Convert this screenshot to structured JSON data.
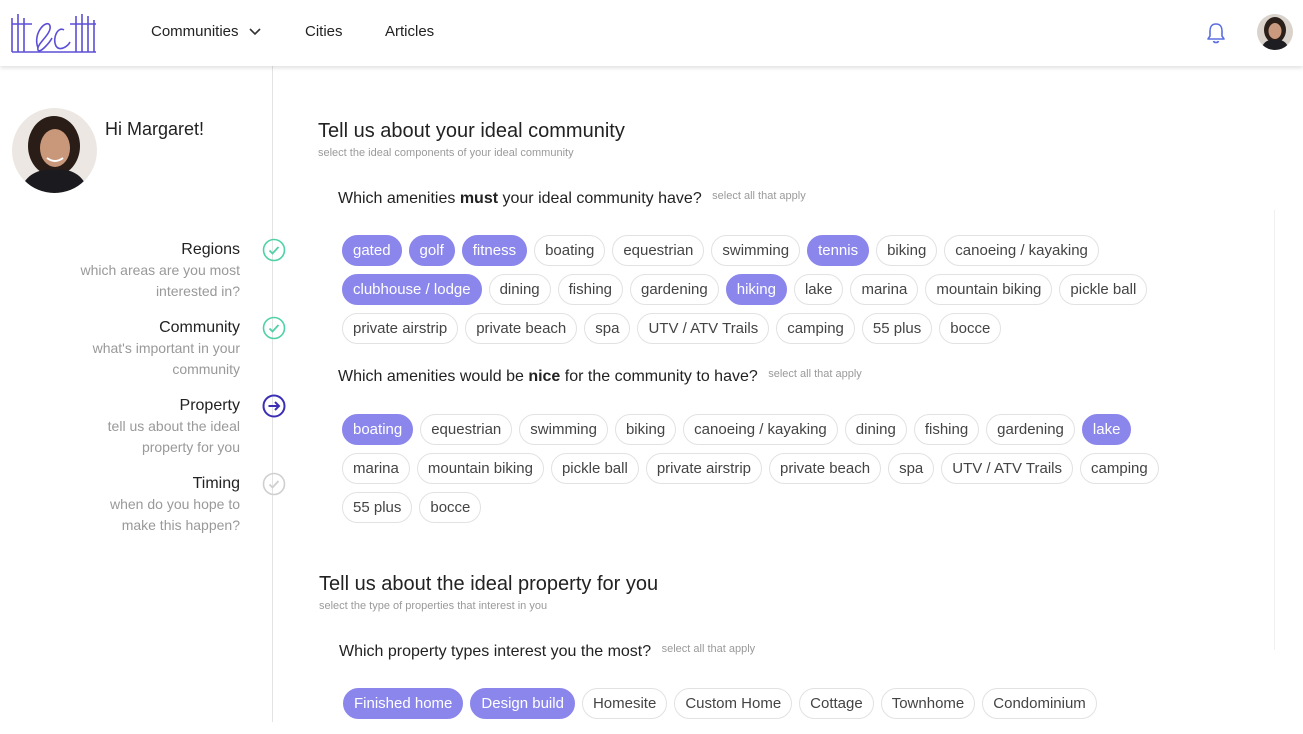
{
  "header": {
    "nav": [
      {
        "label": "Communities",
        "has_dropdown": true
      },
      {
        "label": "Cities"
      },
      {
        "label": "Articles"
      }
    ]
  },
  "sidebar": {
    "greeting": "Hi Margaret!",
    "steps": [
      {
        "title": "Regions",
        "subtitle_lines": [
          "which areas are you most",
          "interested in?"
        ],
        "status": "complete"
      },
      {
        "title": "Community",
        "subtitle_lines": [
          "what's important in your",
          "community"
        ],
        "status": "complete"
      },
      {
        "title": "Property",
        "subtitle_lines": [
          "tell us about the ideal",
          "property for you"
        ],
        "status": "current"
      },
      {
        "title": "Timing",
        "subtitle_lines": [
          "when do you hope to",
          "make this happen?"
        ],
        "status": "pending"
      }
    ]
  },
  "community_section": {
    "title": "Tell us about your ideal community",
    "subtitle": "select the ideal components of your ideal community",
    "must": {
      "question_pre": "Which amenities ",
      "question_bold": "must",
      "question_post": " your ideal community have?",
      "hint": "select all that apply",
      "chips": [
        {
          "label": "gated",
          "selected": true
        },
        {
          "label": "golf",
          "selected": true
        },
        {
          "label": "fitness",
          "selected": true
        },
        {
          "label": "boating",
          "selected": false
        },
        {
          "label": "equestrian",
          "selected": false
        },
        {
          "label": "swimming",
          "selected": false
        },
        {
          "label": "tennis",
          "selected": true
        },
        {
          "label": "biking",
          "selected": false
        },
        {
          "label": "canoeing / kayaking",
          "selected": false
        },
        {
          "label": "clubhouse / lodge",
          "selected": true
        },
        {
          "label": "dining",
          "selected": false
        },
        {
          "label": "fishing",
          "selected": false
        },
        {
          "label": "gardening",
          "selected": false
        },
        {
          "label": "hiking",
          "selected": true
        },
        {
          "label": "lake",
          "selected": false
        },
        {
          "label": "marina",
          "selected": false
        },
        {
          "label": "mountain biking",
          "selected": false
        },
        {
          "label": "pickle ball",
          "selected": false
        },
        {
          "label": "private airstrip",
          "selected": false
        },
        {
          "label": "private beach",
          "selected": false
        },
        {
          "label": "spa",
          "selected": false
        },
        {
          "label": "UTV / ATV Trails",
          "selected": false
        },
        {
          "label": "camping",
          "selected": false
        },
        {
          "label": "55 plus",
          "selected": false
        },
        {
          "label": "bocce",
          "selected": false
        }
      ]
    },
    "nice": {
      "question_pre": "Which amenities would be ",
      "question_bold": "nice",
      "question_post": " for the community to have?",
      "hint": "select all that apply",
      "chips": [
        {
          "label": "boating",
          "selected": true
        },
        {
          "label": "equestrian",
          "selected": false
        },
        {
          "label": "swimming",
          "selected": false
        },
        {
          "label": "biking",
          "selected": false
        },
        {
          "label": "canoeing / kayaking",
          "selected": false
        },
        {
          "label": "dining",
          "selected": false
        },
        {
          "label": "fishing",
          "selected": false
        },
        {
          "label": "gardening",
          "selected": false
        },
        {
          "label": "lake",
          "selected": true
        },
        {
          "label": "marina",
          "selected": false
        },
        {
          "label": "mountain biking",
          "selected": false
        },
        {
          "label": "pickle ball",
          "selected": false
        },
        {
          "label": "private airstrip",
          "selected": false
        },
        {
          "label": "private beach",
          "selected": false
        },
        {
          "label": "spa",
          "selected": false
        },
        {
          "label": "UTV / ATV Trails",
          "selected": false
        },
        {
          "label": "camping",
          "selected": false
        },
        {
          "label": "55 plus",
          "selected": false
        },
        {
          "label": "bocce",
          "selected": false
        }
      ]
    }
  },
  "property_section": {
    "title": "Tell us about the ideal property for you",
    "subtitle": "select the type of properties that interest in you",
    "question": "Which property types interest you the most?",
    "hint": "select all that apply",
    "chips": [
      {
        "label": "Finished home",
        "selected": true
      },
      {
        "label": "Design build",
        "selected": true
      },
      {
        "label": "Homesite",
        "selected": false
      },
      {
        "label": "Custom Home",
        "selected": false
      },
      {
        "label": "Cottage",
        "selected": false
      },
      {
        "label": "Townhome",
        "selected": false
      },
      {
        "label": "Condominium",
        "selected": false
      }
    ]
  },
  "colors": {
    "accent": "#8b86ec",
    "check_green": "#4fd1a5",
    "current_step": "#3b2fb5",
    "logo": "#5b4fd6",
    "bell": "#5b6ee1"
  }
}
